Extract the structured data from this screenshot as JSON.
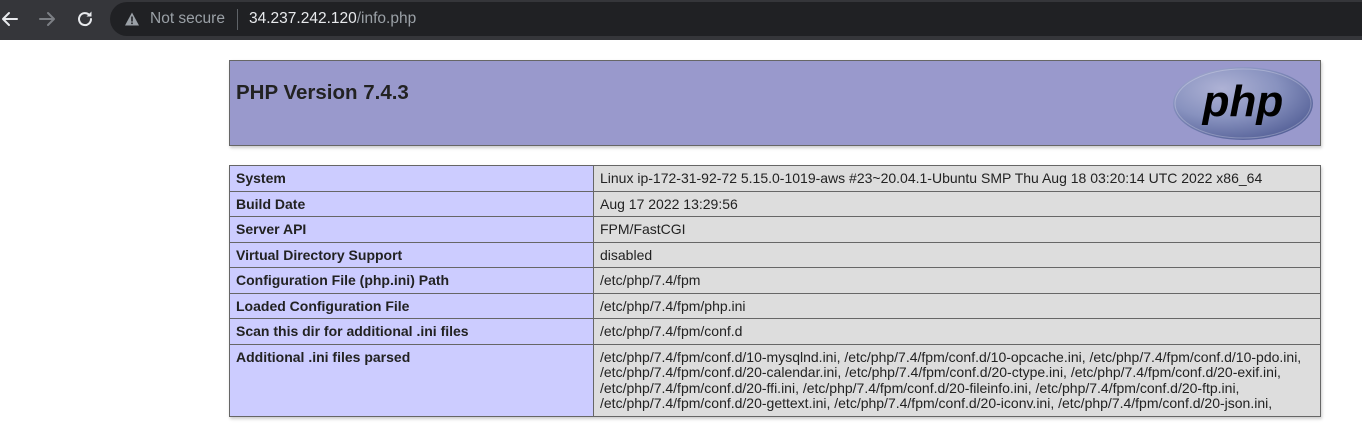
{
  "browser": {
    "security_label": "Not secure",
    "url_host": "34.237.242.120",
    "url_path": "/info.php"
  },
  "page": {
    "title": "PHP Version 7.4.3",
    "logo_text": "php",
    "rows": [
      {
        "key": "System",
        "value": "Linux ip-172-31-92-72 5.15.0-1019-aws #23~20.04.1-Ubuntu SMP Thu Aug 18 03:20:14 UTC 2022 x86_64"
      },
      {
        "key": "Build Date",
        "value": "Aug 17 2022 13:29:56"
      },
      {
        "key": "Server API",
        "value": "FPM/FastCGI"
      },
      {
        "key": "Virtual Directory Support",
        "value": "disabled"
      },
      {
        "key": "Configuration File (php.ini) Path",
        "value": "/etc/php/7.4/fpm"
      },
      {
        "key": "Loaded Configuration File",
        "value": "/etc/php/7.4/fpm/php.ini"
      },
      {
        "key": "Scan this dir for additional .ini files",
        "value": "/etc/php/7.4/fpm/conf.d"
      },
      {
        "key": "Additional .ini files parsed",
        "value_lines": [
          "/etc/php/7.4/fpm/conf.d/10-mysqlnd.ini, /etc/php/7.4/fpm/conf.d/10-opcache.ini, /etc/php/7.4/fpm/conf.d/10-pdo.ini,",
          "/etc/php/7.4/fpm/conf.d/20-calendar.ini, /etc/php/7.4/fpm/conf.d/20-ctype.ini, /etc/php/7.4/fpm/conf.d/20-exif.ini,",
          "/etc/php/7.4/fpm/conf.d/20-ffi.ini, /etc/php/7.4/fpm/conf.d/20-fileinfo.ini, /etc/php/7.4/fpm/conf.d/20-ftp.ini,",
          "/etc/php/7.4/fpm/conf.d/20-gettext.ini, /etc/php/7.4/fpm/conf.d/20-iconv.ini, /etc/php/7.4/fpm/conf.d/20-json.ini,"
        ]
      }
    ]
  },
  "colors": {
    "chrome_bg": "#35363a",
    "omnibox_bg": "#202124",
    "header_bg": "#9999cc",
    "key_cell_bg": "#ccccff",
    "value_cell_bg": "#dddddd"
  },
  "icons": {
    "back": "arrow-left-icon",
    "forward": "arrow-right-icon",
    "reload": "reload-icon",
    "security": "warning-triangle-icon"
  }
}
